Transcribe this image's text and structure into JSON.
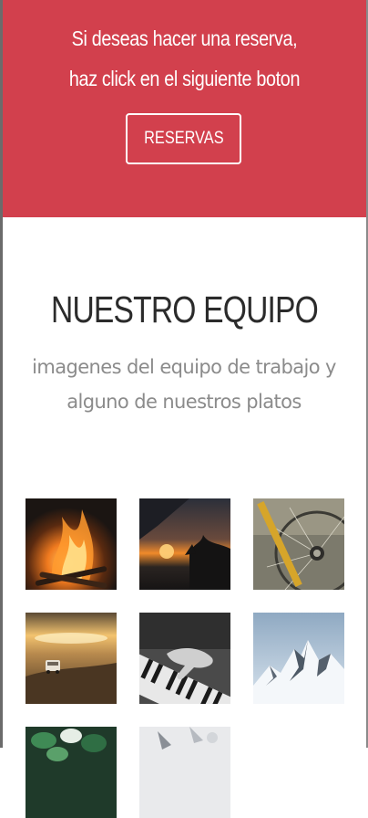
{
  "reservation": {
    "line1": "Si deseas hacer una reserva,",
    "line2": "haz click en el siguiente boton",
    "button_label": "RESERVAS",
    "background_color": "#d2404d"
  },
  "team": {
    "title": "NUESTRO EQUIPO",
    "subtitle": "imagenes del equipo de trabajo y alguno de nuestros platos"
  },
  "gallery": {
    "items": [
      {
        "icon": "campfire-photo"
      },
      {
        "icon": "sunset-silhouette-photo"
      },
      {
        "icon": "bicycle-wheel-photo"
      },
      {
        "icon": "desert-road-car-photo"
      },
      {
        "icon": "piano-hands-photo"
      },
      {
        "icon": "snowy-mountains-photo"
      },
      {
        "icon": "green-leaves-photo"
      },
      {
        "icon": "light-abstract-photo"
      }
    ]
  }
}
